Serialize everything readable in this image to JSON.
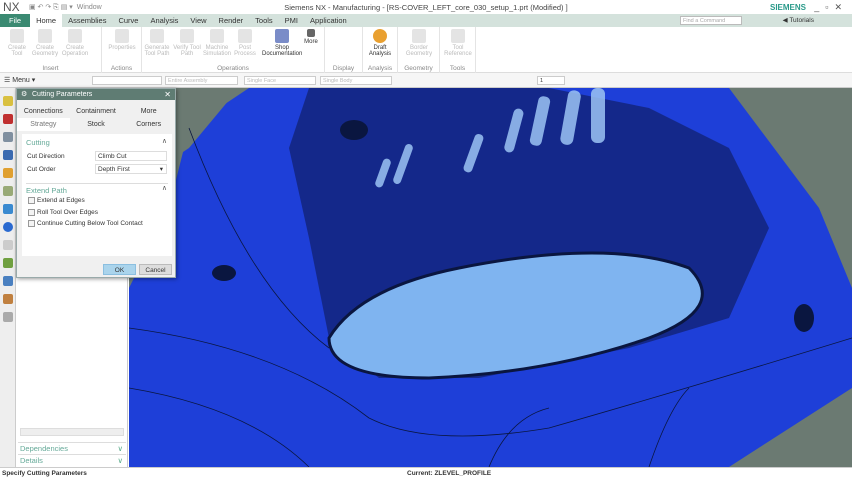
{
  "titlebar": {
    "logo": "NX",
    "window_menu": "Window",
    "title": "Siemens NX - Manufacturing - [RS-COVER_LEFT_core_030_setup_1.prt (Modified) ]",
    "brand": "SIEMENS"
  },
  "tabs": [
    "File",
    "Home",
    "Assemblies",
    "Curve",
    "Analysis",
    "View",
    "Render",
    "Tools",
    "PMI",
    "Application"
  ],
  "search_placeholder": "Find a Command",
  "tutorials": "Tutorials",
  "ribbon": {
    "buttons": [
      "Create Tool",
      "Create Geometry",
      "Create Operation",
      "Properties",
      "Generate Tool Path",
      "Verify Tool Path",
      "Machine Simulation",
      "Post Process",
      "Shop Documentation",
      "More",
      "Draft Analysis",
      "Border Geometry",
      "Tool Reference"
    ],
    "groups": [
      "Insert",
      "Actions",
      "Operations",
      "Display",
      "Analysis",
      "Geometry",
      "Tools"
    ]
  },
  "toolbar2": {
    "menu": "Menu",
    "filters": [
      "",
      "Entire Assembly",
      "Single Face",
      "Single Body",
      "1"
    ]
  },
  "dialog": {
    "title": "Cutting Parameters",
    "tabs_row1": [
      "Connections",
      "Containment",
      "More"
    ],
    "tabs_row2": [
      "Strategy",
      "Stock",
      "Corners"
    ],
    "section_cutting": "Cutting",
    "cut_direction_label": "Cut Direction",
    "cut_direction": "Climb Cut",
    "cut_order_label": "Cut Order",
    "cut_order": "Depth First",
    "section_extend": "Extend Path",
    "checkboxes": [
      "Extend at Edges",
      "Roll Tool Over Edges",
      "Continue Cutting Below Tool Contact"
    ],
    "ok": "OK",
    "cancel": "Cancel"
  },
  "nav": {
    "dependencies": "Dependencies",
    "details": "Details"
  },
  "status": {
    "left": "Specify Cutting Parameters",
    "right": "Current: ZLEVEL_PROFILE"
  },
  "colors": {
    "part_blue": "#1e3fd8",
    "floor": "#7fb4f0",
    "bg": "#6b7a72",
    "accent": "#3b8a72"
  }
}
